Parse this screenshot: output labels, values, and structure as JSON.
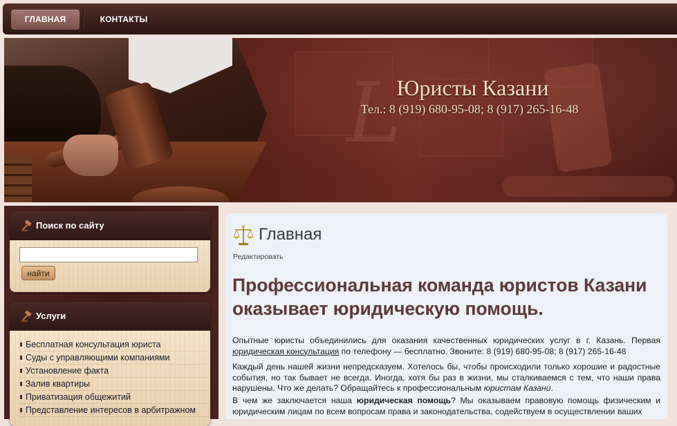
{
  "nav": {
    "home_label": "ГЛАВНАЯ",
    "contacts_label": "КОНТАКТЫ"
  },
  "banner": {
    "title": "Юристы Казани",
    "phone": "Тел.: 8 (919) 680-95-08; 8 (917) 265-16-48"
  },
  "sidebar": {
    "search": {
      "title": "Поиск по сайту",
      "input_value": "",
      "button_label": "найти"
    },
    "services": {
      "title": "Услуги",
      "items": [
        "Бесплатная консультация юриста",
        "Суды с управляющими компаниями",
        "Установление факта",
        "Залив квартиры",
        "Приватизация общежитий",
        "Представление интересов в арбитражном"
      ]
    }
  },
  "content": {
    "page_title": "Главная",
    "edit_link": "Редактировать",
    "heading": "Профессиональная команда юристов Казани оказывает юридическую помощь.",
    "p1_a": "Опытные юристы объединились для оказания качественных юридических услуг в г. Казань. Первая ",
    "p1_link": "юридическая консультация",
    "p1_b": " по телефону — бесплатно. Звоните: 8 (919) 680-95-08; 8 (917) 265-16-48",
    "p2_a": "Каждый день нашей жизни непредсказуем. Хотелось бы, чтобы происходили только хорошие и радостные события, но так бывает не всегда. Иногда, хотя бы раз в жизни, мы сталкиваемся с тем, что наши права нарушены. Что же делать? Обращайтесь к профессиональным ",
    "p2_em": "юристам Казани",
    "p2_b": ".",
    "p3_a": "В чем же заключается наша ",
    "p3_strong": "юридическая помощь",
    "p3_b": "? Мы оказываем правовую помощь физическим и юридическим лицам по всем вопросам права и законодательства, содействуем в осуществлении ваших"
  },
  "colors": {
    "nav_bg": "#3a1e1b",
    "heading": "#5a3a3a",
    "banner_text": "#f1dfc2"
  }
}
